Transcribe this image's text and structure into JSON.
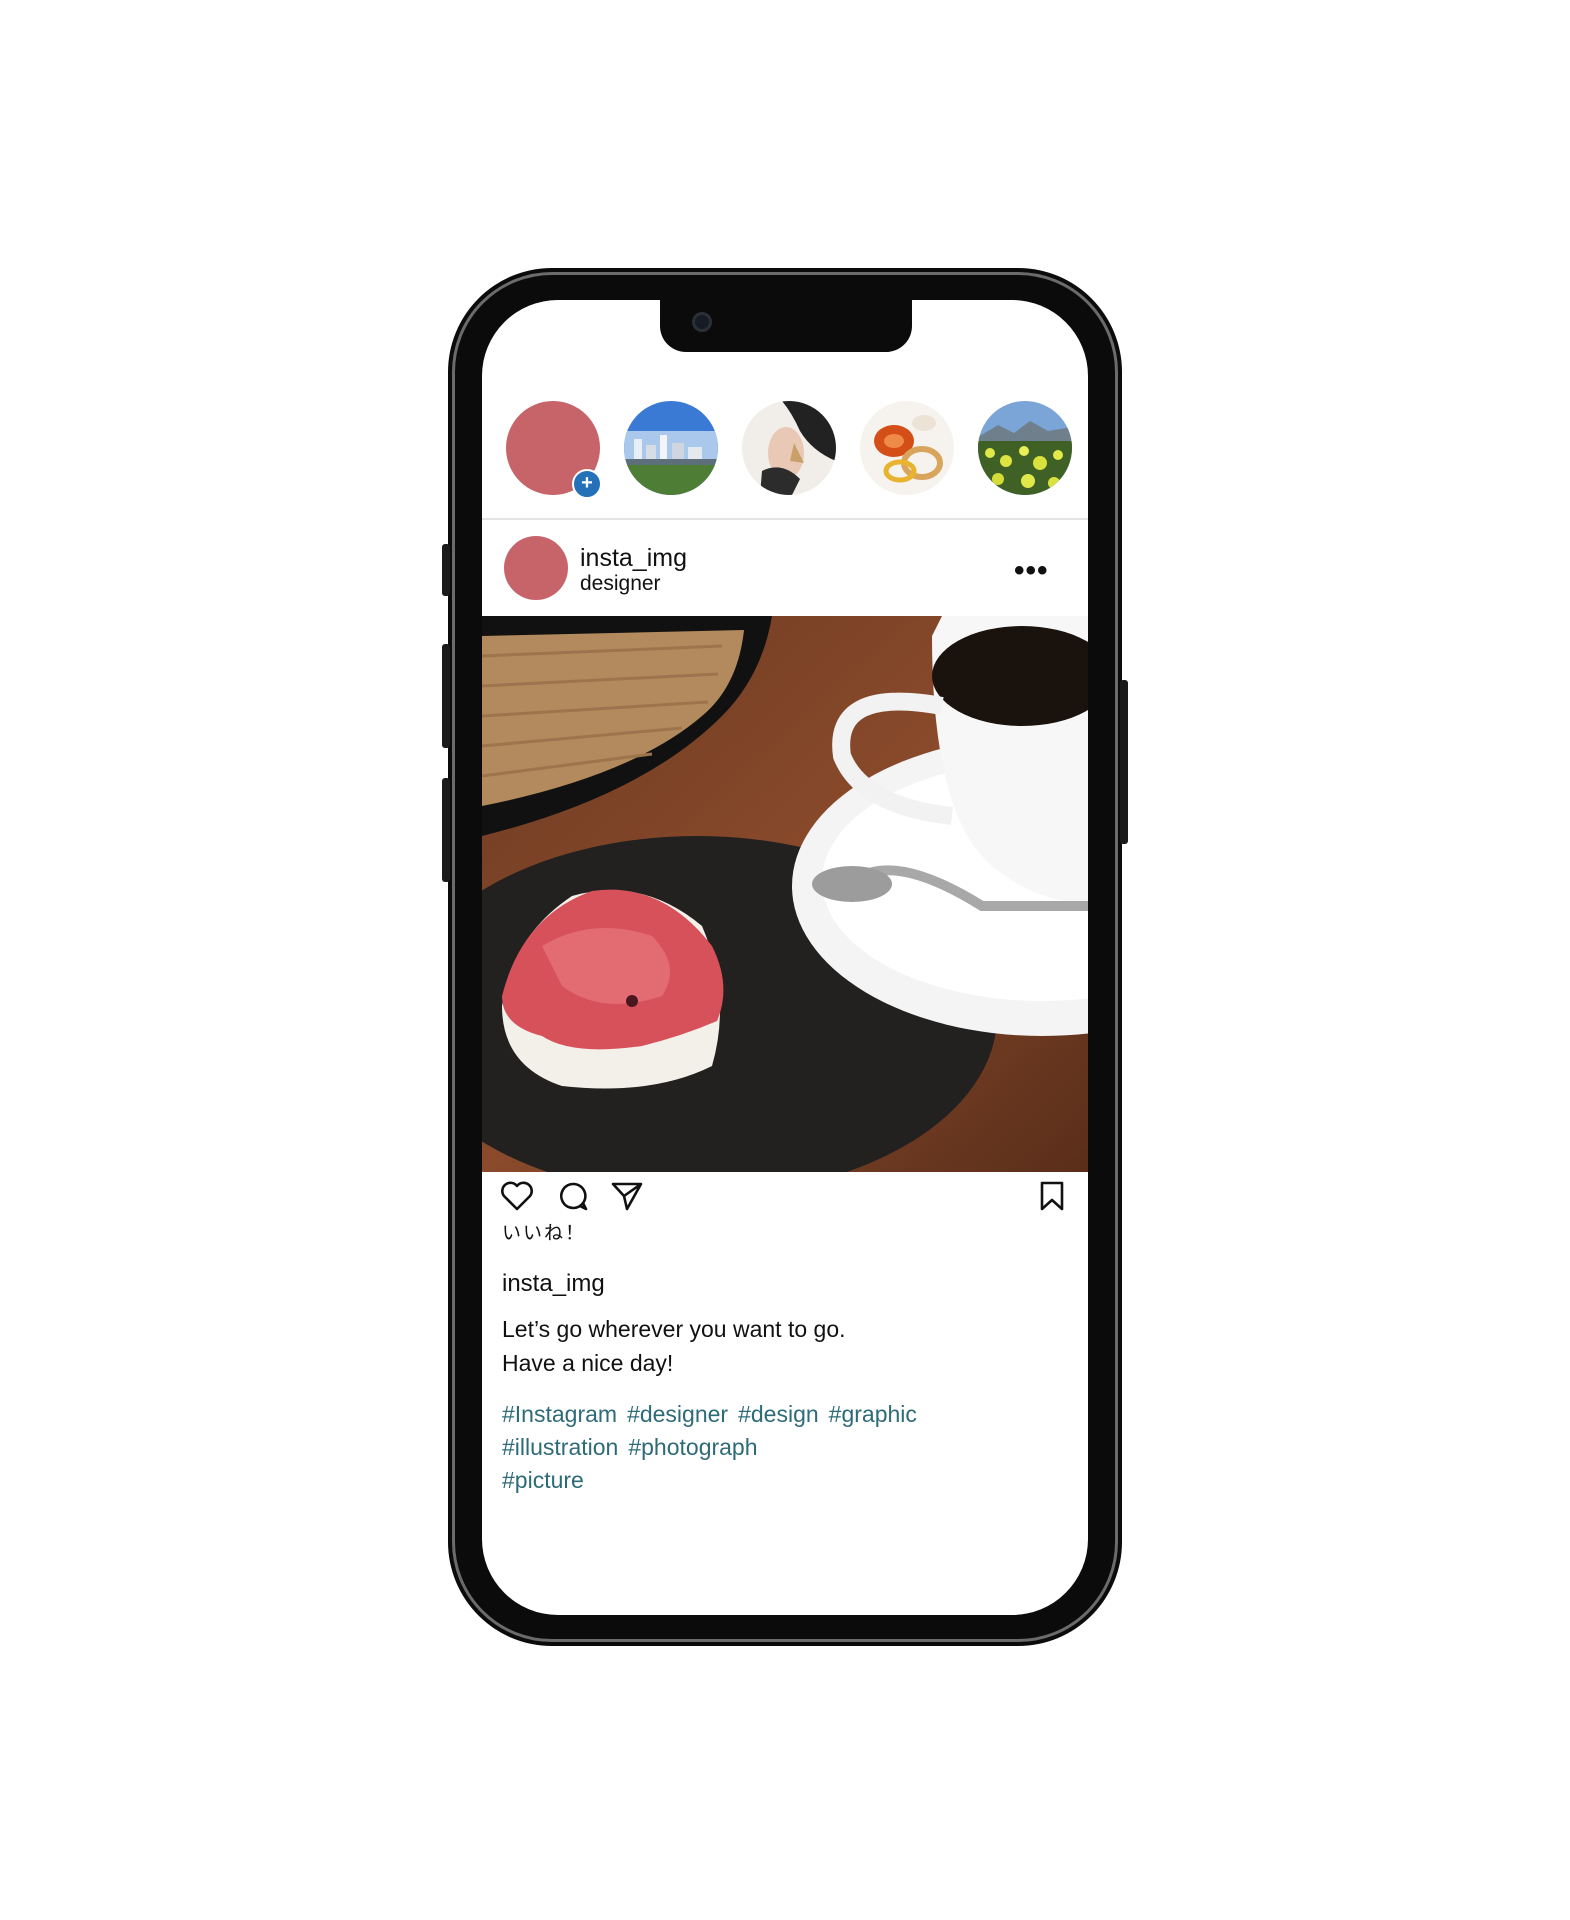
{
  "stories": [
    {
      "name": "story-own",
      "color": "#c6646a",
      "add_icon": "plus-icon"
    },
    {
      "name": "story-city",
      "colors": [
        "#2f6fcf",
        "#9cc0ea",
        "#4d7a35"
      ]
    },
    {
      "name": "story-earring",
      "colors": [
        "#f3efeb",
        "#2a2a2a",
        "#c9a06a"
      ]
    },
    {
      "name": "story-amber",
      "colors": [
        "#f7f5f2",
        "#d9581b",
        "#e6c07a"
      ]
    },
    {
      "name": "story-flowers",
      "colors": [
        "#6b96c9",
        "#dfe64a",
        "#3e5e24"
      ]
    }
  ],
  "post": {
    "username": "insta_img",
    "subtitle": "designer",
    "avatar_color": "#c6646a",
    "more_label": "•••",
    "likes_label": "いいね！",
    "caption_user": "insta_img",
    "caption_line1": "Let’s go wherever you want to go.",
    "caption_line2": "Have a nice day!",
    "hashtags": [
      "#Instagram",
      "#designer",
      "#design",
      "#graphic",
      "#illustration",
      "#photograph",
      "#picture"
    ],
    "hashtag_color": "#2d6b78"
  },
  "icons": [
    "heart-icon",
    "comment-icon",
    "send-icon",
    "bookmark-icon",
    "more-icon"
  ]
}
